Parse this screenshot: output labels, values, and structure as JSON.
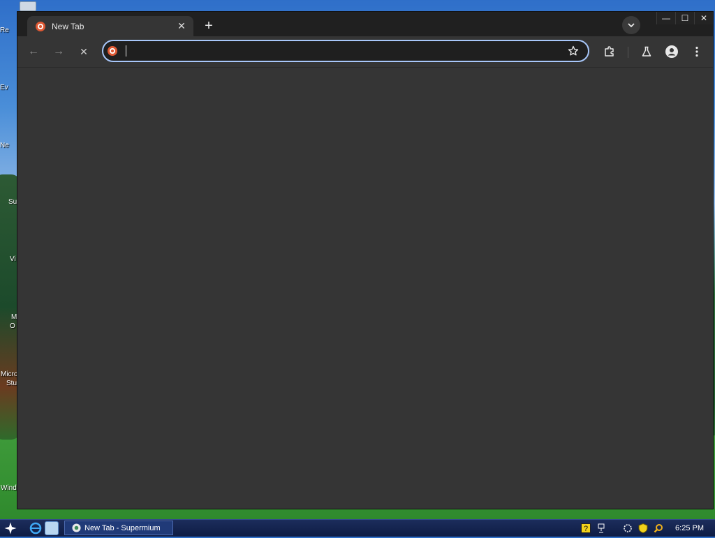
{
  "desktop": {
    "icon_labels": [
      "Re",
      "Ev",
      "Ne",
      "Su",
      "Vi",
      "M",
      "O",
      "Micro",
      "Stu",
      "Wind"
    ]
  },
  "browser": {
    "tab": {
      "title": "New Tab",
      "close_glyph": "✕",
      "favicon": "duckduckgo-icon"
    },
    "new_tab_glyph": "+",
    "window_controls": {
      "minimize": "—",
      "maximize": "☐",
      "close": "✕"
    },
    "toolbar": {
      "back_glyph": "←",
      "forward_glyph": "→",
      "stop_glyph": "✕",
      "omnibox": {
        "value": "",
        "placeholder": ""
      }
    },
    "colors": {
      "frame": "#202020",
      "surface": "#353535",
      "omnibox_border": "#a8c7fa"
    }
  },
  "taskbar": {
    "task_button_label": "New Tab - Supermium",
    "clock": "6:25 PM"
  }
}
